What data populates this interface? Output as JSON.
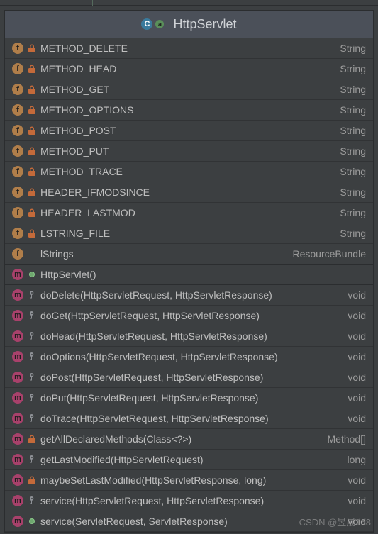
{
  "header": {
    "title": "HttpServlet"
  },
  "fields": [
    {
      "name": "METHOD_DELETE",
      "type": "String",
      "locked": true
    },
    {
      "name": "METHOD_HEAD",
      "type": "String",
      "locked": true
    },
    {
      "name": "METHOD_GET",
      "type": "String",
      "locked": true
    },
    {
      "name": "METHOD_OPTIONS",
      "type": "String",
      "locked": true
    },
    {
      "name": "METHOD_POST",
      "type": "String",
      "locked": true
    },
    {
      "name": "METHOD_PUT",
      "type": "String",
      "locked": true
    },
    {
      "name": "METHOD_TRACE",
      "type": "String",
      "locked": true
    },
    {
      "name": "HEADER_IFMODSINCE",
      "type": "String",
      "locked": true
    },
    {
      "name": "HEADER_LASTMOD",
      "type": "String",
      "locked": true
    },
    {
      "name": "LSTRING_FILE",
      "type": "String",
      "locked": true
    },
    {
      "name": "lStrings",
      "type": "ResourceBundle",
      "locked": false
    }
  ],
  "constructors": [
    {
      "name": "HttpServlet()"
    }
  ],
  "methods": [
    {
      "name": "doDelete(HttpServletRequest, HttpServletResponse)",
      "type": "void",
      "access": "key"
    },
    {
      "name": "doGet(HttpServletRequest, HttpServletResponse)",
      "type": "void",
      "access": "key"
    },
    {
      "name": "doHead(HttpServletRequest, HttpServletResponse)",
      "type": "void",
      "access": "key"
    },
    {
      "name": "doOptions(HttpServletRequest, HttpServletResponse)",
      "type": "void",
      "access": "key"
    },
    {
      "name": "doPost(HttpServletRequest, HttpServletResponse)",
      "type": "void",
      "access": "key"
    },
    {
      "name": "doPut(HttpServletRequest, HttpServletResponse)",
      "type": "void",
      "access": "key"
    },
    {
      "name": "doTrace(HttpServletRequest, HttpServletResponse)",
      "type": "void",
      "access": "key"
    },
    {
      "name": "getAllDeclaredMethods(Class<?>)",
      "type": "Method[]",
      "access": "lock"
    },
    {
      "name": "getLastModified(HttpServletRequest)",
      "type": "long",
      "access": "key"
    },
    {
      "name": "maybeSetLastModified(HttpServletResponse, long)",
      "type": "void",
      "access": "lock"
    },
    {
      "name": "service(HttpServletRequest, HttpServletResponse)",
      "type": "void",
      "access": "key"
    },
    {
      "name": "service(ServletRequest, ServletResponse)",
      "type": "void",
      "access": "dot"
    }
  ],
  "watermark": "CSDN @昱晟168"
}
